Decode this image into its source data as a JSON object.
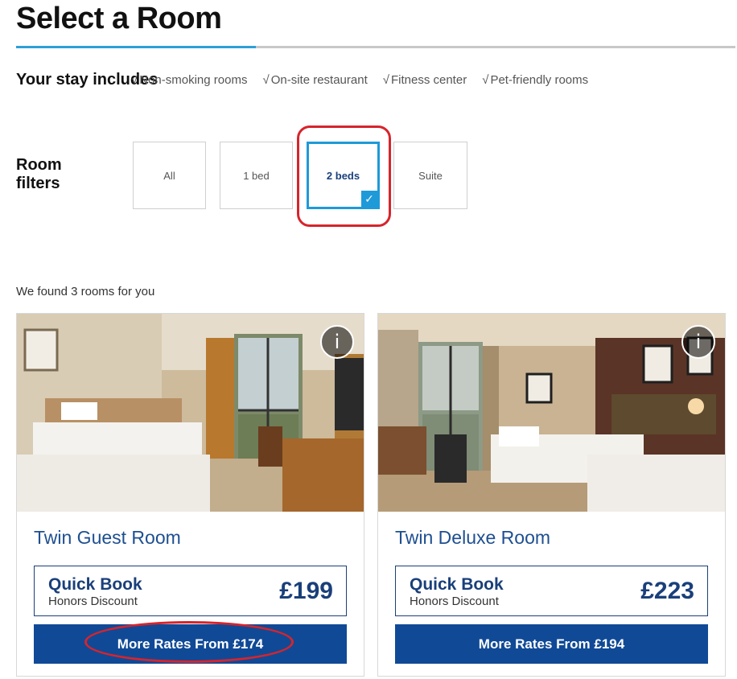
{
  "header": {
    "title": "Select a Room",
    "accent_color": "#2e9fd6"
  },
  "stay": {
    "label": "Your stay includes",
    "check_glyph": "√",
    "amenities": [
      "Non-smoking rooms",
      "On-site restaurant",
      "Fitness center",
      "Pet-friendly rooms"
    ]
  },
  "filters": {
    "label": "Room filters",
    "options": [
      "All",
      "1 bed",
      "2 beds",
      "Suite"
    ],
    "selected": "2 beds",
    "check_glyph": "✓"
  },
  "results": {
    "text": "We found 3 rooms for you"
  },
  "rooms": [
    {
      "name": "Twin Guest Room",
      "info_glyph": "i",
      "quick_book_label": "Quick Book",
      "quick_book_sub": "Honors Discount",
      "price": "£199",
      "more_rates": "More Rates From £174"
    },
    {
      "name": "Twin Deluxe Room",
      "info_glyph": "i",
      "quick_book_label": "Quick Book",
      "quick_book_sub": "Honors Discount",
      "price": "£223",
      "more_rates": "More Rates From £194"
    }
  ],
  "colors": {
    "brand_blue": "#104a96",
    "selected_blue": "#1e9ad8",
    "annotation_red": "#d7242c"
  }
}
